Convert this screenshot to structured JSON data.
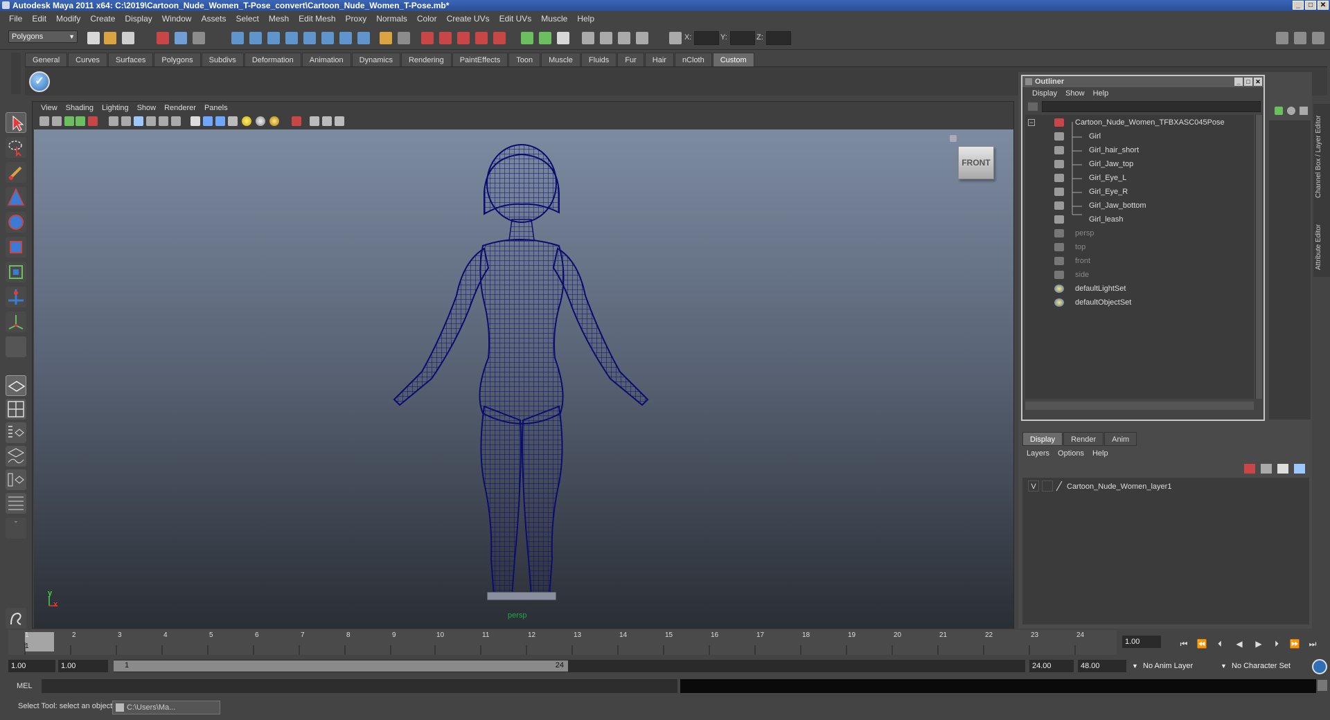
{
  "window": {
    "title": "Autodesk Maya 2011 x64: C:\\2019\\Cartoon_Nude_Women_T-Pose_convert\\Cartoon_Nude_Women_T-Pose.mb*",
    "minimize": "_",
    "maximize": "□",
    "close": "✕"
  },
  "menubar": [
    "File",
    "Edit",
    "Modify",
    "Create",
    "Display",
    "Window",
    "Assets",
    "Select",
    "Mesh",
    "Edit Mesh",
    "Proxy",
    "Normals",
    "Color",
    "Create UVs",
    "Edit UVs",
    "Muscle",
    "Help"
  ],
  "statusline": {
    "mode": "Polygons",
    "coord_x": "X:",
    "coord_y": "Y:",
    "coord_z": "Z:"
  },
  "shelf": {
    "tabs": [
      "General",
      "Curves",
      "Surfaces",
      "Polygons",
      "Subdivs",
      "Deformation",
      "Animation",
      "Dynamics",
      "Rendering",
      "PaintEffects",
      "Toon",
      "Muscle",
      "Fluids",
      "Fur",
      "Hair",
      "nCloth",
      "Custom"
    ],
    "active_tab": "Custom"
  },
  "panel": {
    "menu": [
      "View",
      "Shading",
      "Lighting",
      "Show",
      "Renderer",
      "Panels"
    ],
    "viewcube_label": "FRONT",
    "camera_label": "persp",
    "axis_y": "y",
    "axis_x": "x"
  },
  "outliner": {
    "title": "Outliner",
    "menu": [
      "Display",
      "Show",
      "Help"
    ],
    "root": "Cartoon_Nude_Women_TFBXASC045Pose",
    "children": [
      "Girl",
      "Girl_hair_short",
      "Girl_Jaw_top",
      "Girl_Eye_L",
      "Girl_Eye_R",
      "Girl_Jaw_bottom",
      "Girl_leash"
    ],
    "cameras": [
      "persp",
      "top",
      "front",
      "side"
    ],
    "sets": [
      "defaultLightSet",
      "defaultObjectSet"
    ]
  },
  "side_tabs": [
    "Channel Box / Layer Editor",
    "Attribute Editor"
  ],
  "layer_editor": {
    "tabs": [
      "Display",
      "Render",
      "Anim"
    ],
    "active_tab": "Display",
    "menu": [
      "Layers",
      "Options",
      "Help"
    ],
    "layers": [
      {
        "visible": "V",
        "name": "Cartoon_Nude_Women_layer1"
      }
    ]
  },
  "timeline": {
    "ticks": [
      "1",
      "2",
      "3",
      "4",
      "5",
      "6",
      "7",
      "8",
      "9",
      "10",
      "11",
      "12",
      "13",
      "14",
      "15",
      "16",
      "17",
      "18",
      "19",
      "20",
      "21",
      "22",
      "23",
      "24"
    ],
    "current_frame_marker": "1",
    "current_time": "1.00"
  },
  "range": {
    "start": "1.00",
    "playback_start": "1.00",
    "slider_start_label": "1",
    "slider_end_label": "24",
    "playback_end": "24.00",
    "end": "48.00",
    "anim_layer": "No Anim Layer",
    "character_set": "No Character Set"
  },
  "commandline": {
    "label": "MEL"
  },
  "helpline": {
    "text": "Select Tool: select an object",
    "task_item": "C:\\Users\\Ma..."
  }
}
